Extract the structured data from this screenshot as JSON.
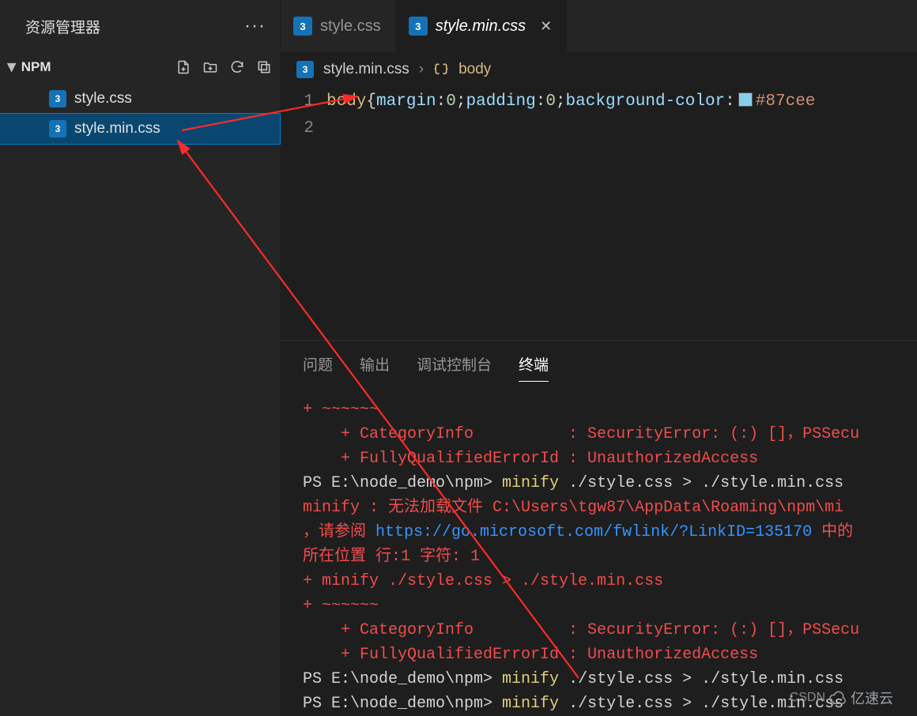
{
  "sidebar": {
    "title": "资源管理器",
    "project": "NPM",
    "items": [
      {
        "label": "style.css"
      },
      {
        "label": "style.min.css"
      }
    ]
  },
  "tabs": [
    {
      "label": "style.css"
    },
    {
      "label": "style.min.css"
    }
  ],
  "breadcrumb": {
    "file": "style.min.css",
    "sep": "›",
    "symbol": "body"
  },
  "editor": {
    "line1": "1",
    "line2": "2",
    "sel": "body",
    "openbr": "{",
    "p1": "margin",
    "colon1": ":",
    "v1": "0",
    "semi1": ";",
    "p2": "padding",
    "colon2": ":",
    "v2": "0",
    "semi2": ";",
    "p3": "background-color",
    "colon3": ":",
    "hex": "#87cee"
  },
  "panel_tabs": {
    "problems": "问题",
    "output": "输出",
    "debug": "调试控制台",
    "terminal": "终端"
  },
  "terminal": {
    "l1": "+ ~~~~~~",
    "l2a": "    + CategoryInfo          : SecurityError: (:) []，PSSecu",
    "l2b": "    + FullyQualifiedErrorId : UnauthorizedAccess",
    "l3a": "PS E:\\node_demo\\npm> ",
    "l3b": "minify",
    "l3c": " ./style.css > ./style.min.css",
    "l4a": "minify : ",
    "l4b": "无法加载文件 ",
    "l4c": "C:\\Users\\tgw87\\AppData\\Roaming\\npm\\mi",
    "l5a": "，请参阅 ",
    "l5b": "https://go.microsoft.com/fwlink/?LinkID=135170",
    "l5c": " 中的",
    "l6": "所在位置 行:1 字符: 1",
    "l7": "+ minify ./style.css > ./style.min.css",
    "l8": "+ ~~~~~~",
    "l9a": "    + CategoryInfo          : SecurityError: (:) []，PSSecu",
    "l9b": "    + FullyQualifiedErrorId : UnauthorizedAccess",
    "l10a": "PS E:\\node_demo\\npm> ",
    "l10b": "minify",
    "l10c": " ./style.css > ./style.min.css",
    "l11a": "PS E:\\node_demo\\npm> ",
    "l11b": "minify",
    "l11c": " ./style.css > ./style.min.css"
  },
  "watermark": "亿速云",
  "watermark2": "CSDN"
}
